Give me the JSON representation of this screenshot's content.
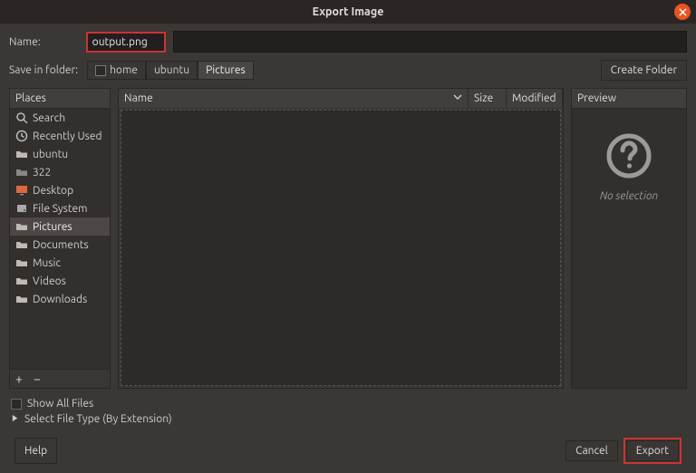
{
  "title": "Export Image",
  "name_label": "Name:",
  "name_value": "output.png",
  "save_in_label": "Save in folder:",
  "path_segments": [
    {
      "label": "home",
      "active": false,
      "hasCheckbox": true
    },
    {
      "label": "ubuntu",
      "active": false,
      "hasCheckbox": false
    },
    {
      "label": "Pictures",
      "active": true,
      "hasCheckbox": false
    }
  ],
  "create_folder_label": "Create Folder",
  "columns": {
    "places": "Places",
    "name": "Name",
    "size": "Size",
    "modified": "Modified",
    "preview": "Preview"
  },
  "places": [
    {
      "label": "Search",
      "icon": "search"
    },
    {
      "label": "Recently Used",
      "icon": "recent"
    },
    {
      "label": "ubuntu",
      "icon": "folder"
    },
    {
      "label": "322",
      "icon": "folder-gray"
    },
    {
      "label": "Desktop",
      "icon": "desktop"
    },
    {
      "label": "File System",
      "icon": "disk"
    },
    {
      "label": "Pictures",
      "icon": "folder",
      "active": true
    },
    {
      "label": "Documents",
      "icon": "folder"
    },
    {
      "label": "Music",
      "icon": "folder"
    },
    {
      "label": "Videos",
      "icon": "folder"
    },
    {
      "label": "Downloads",
      "icon": "folder"
    }
  ],
  "preview_noselection": "No selection",
  "show_all_files": "Show All Files",
  "select_filetype": "Select File Type (By Extension)",
  "buttons": {
    "help": "Help",
    "cancel": "Cancel",
    "export": "Export",
    "add": "+",
    "remove": "−"
  }
}
